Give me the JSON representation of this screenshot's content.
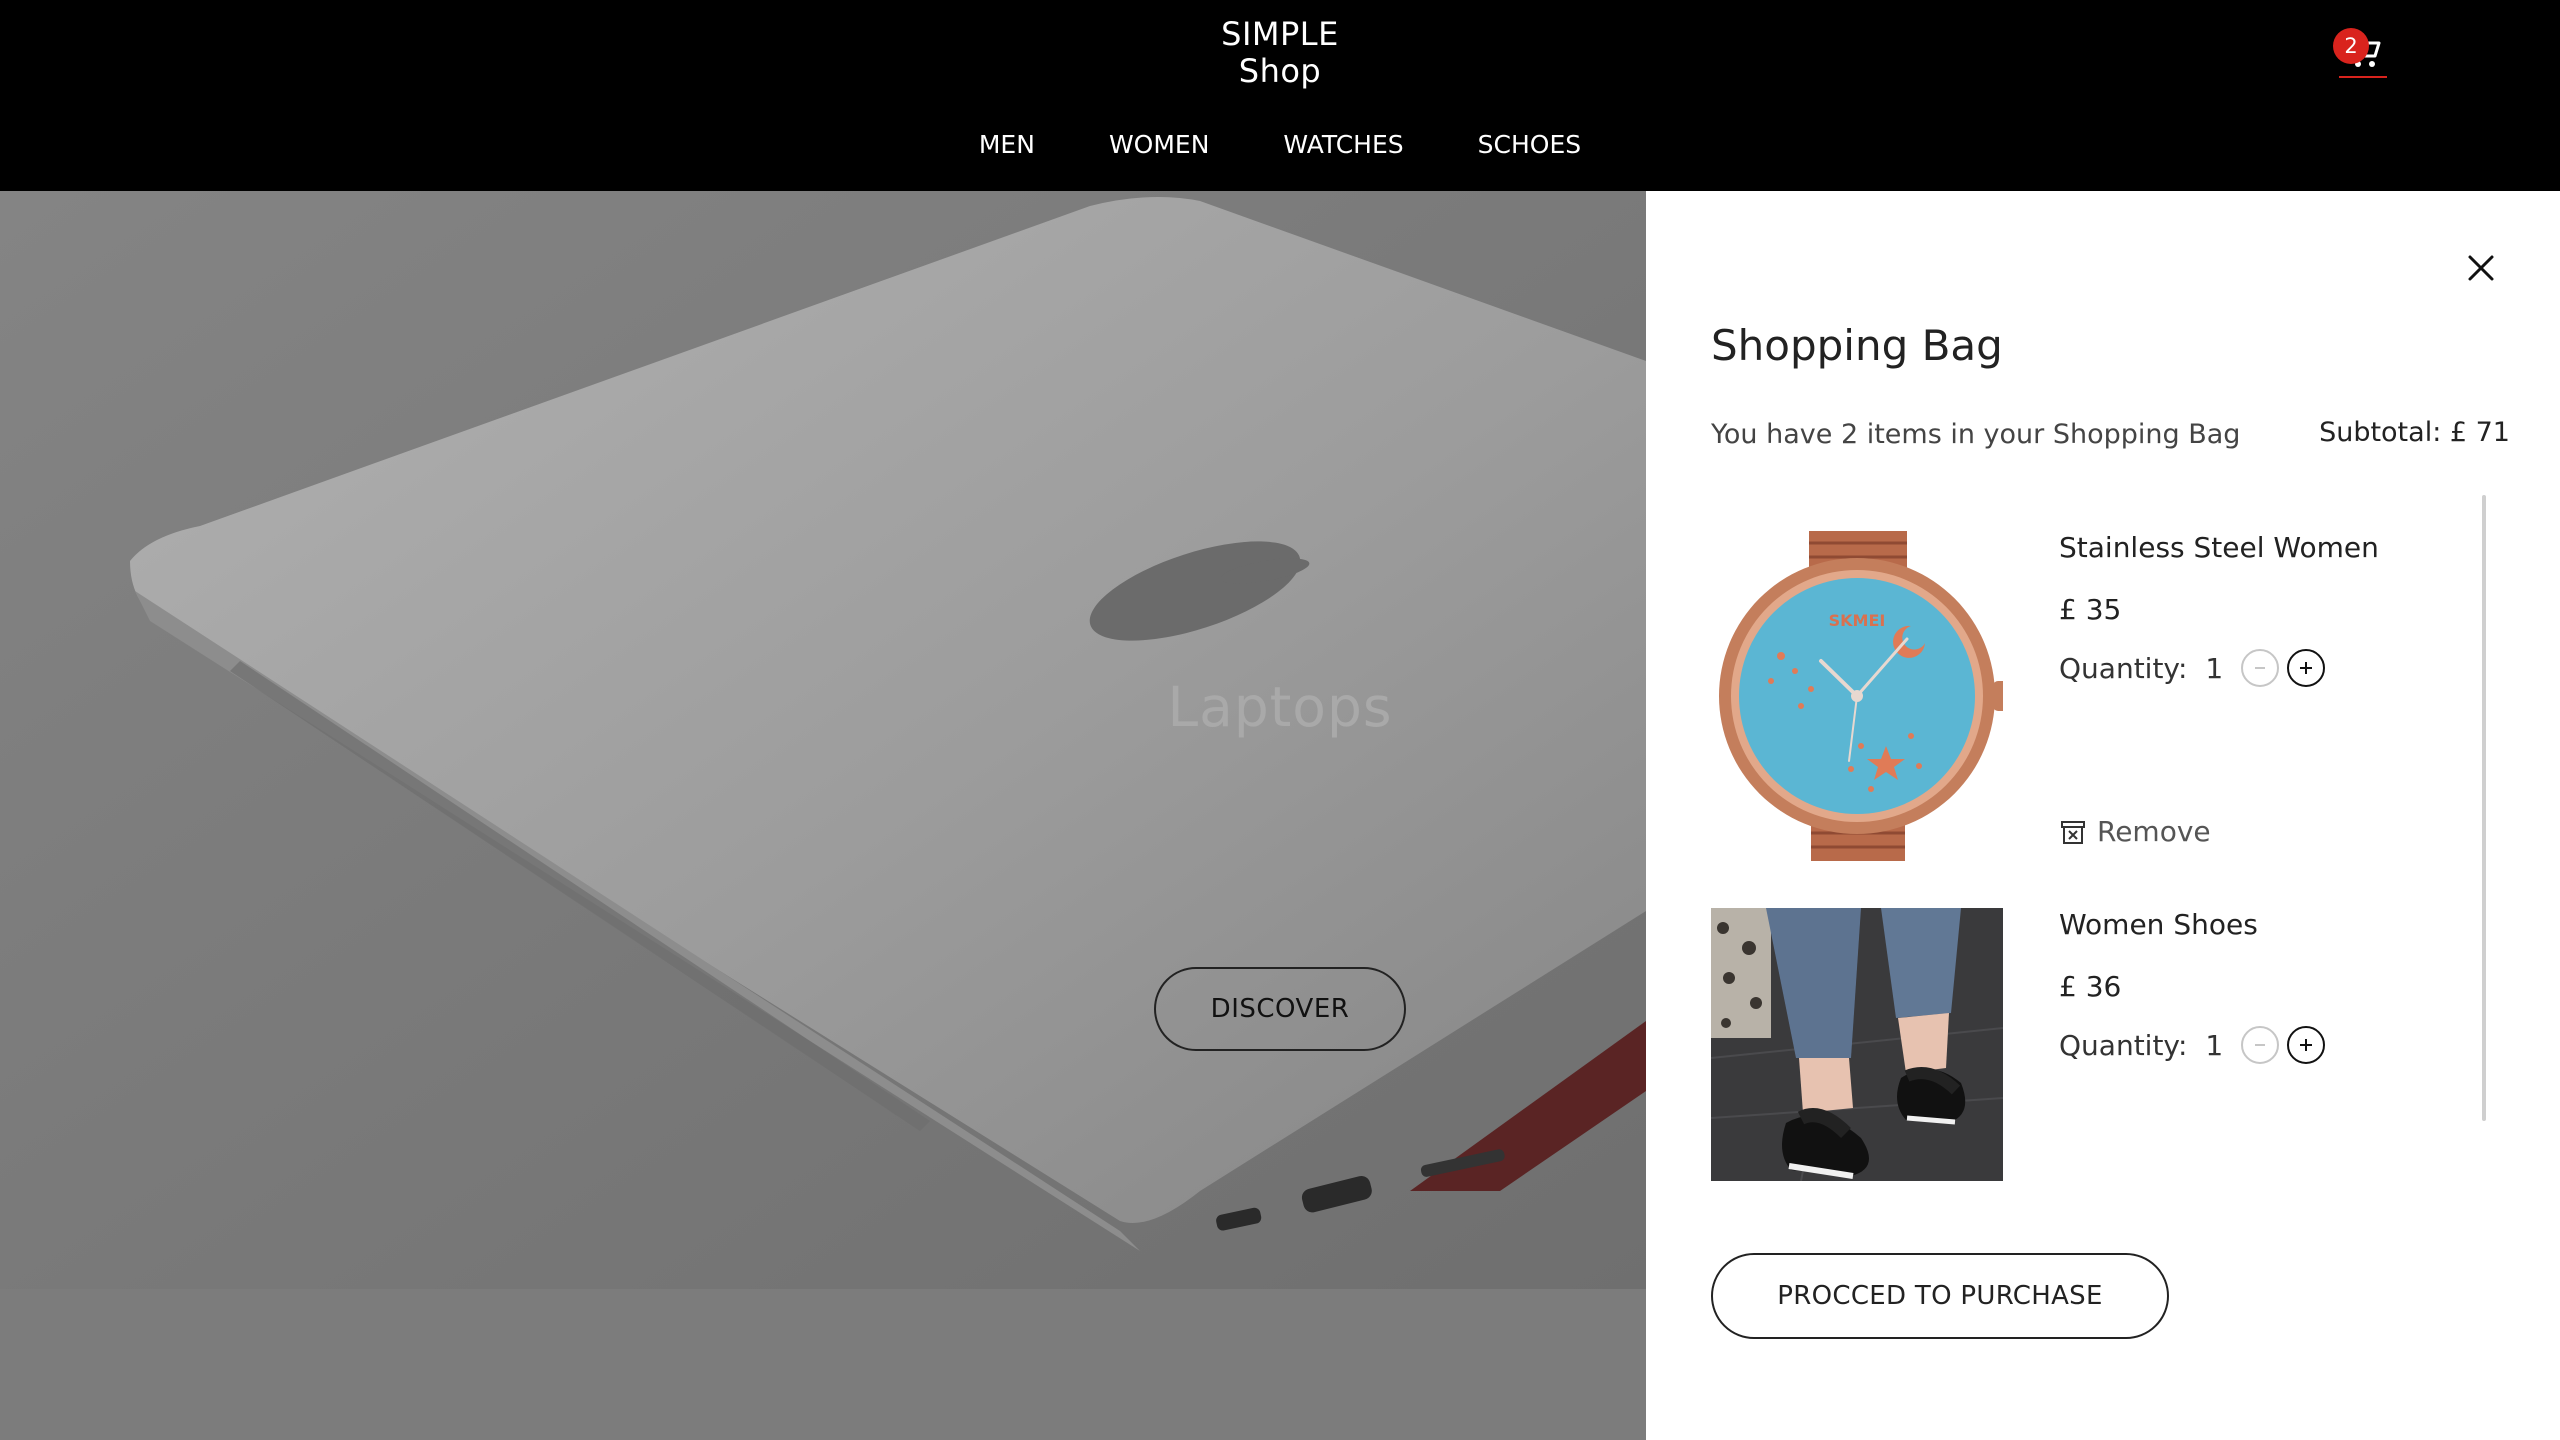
{
  "header": {
    "logo_line1": "SIMPLE",
    "logo_line2": "Shop",
    "nav": [
      {
        "label": "MEN"
      },
      {
        "label": "WOMEN"
      },
      {
        "label": "WATCHES"
      },
      {
        "label": "SCHOES"
      }
    ],
    "cart_count": "2",
    "cart_icon": "shopping-cart-icon",
    "badge_color": "#d9231d"
  },
  "hero": {
    "title": "Laptops",
    "button_label": "DISCOVER"
  },
  "bag": {
    "title": "Shopping Bag",
    "summary": "You have 2 items in your Shopping Bag",
    "subtotal": "Subtotal: £ 71",
    "close_icon": "close-icon",
    "quantity_label": "Quantity:",
    "remove_label": "Remove",
    "items": [
      {
        "name": "Stainless Steel Women",
        "price": "£ 35",
        "quantity": "1"
      },
      {
        "name": "Women Shoes",
        "price": "£ 36",
        "quantity": "1"
      }
    ],
    "purchase_label": "PROCCED TO PURCHASE"
  }
}
